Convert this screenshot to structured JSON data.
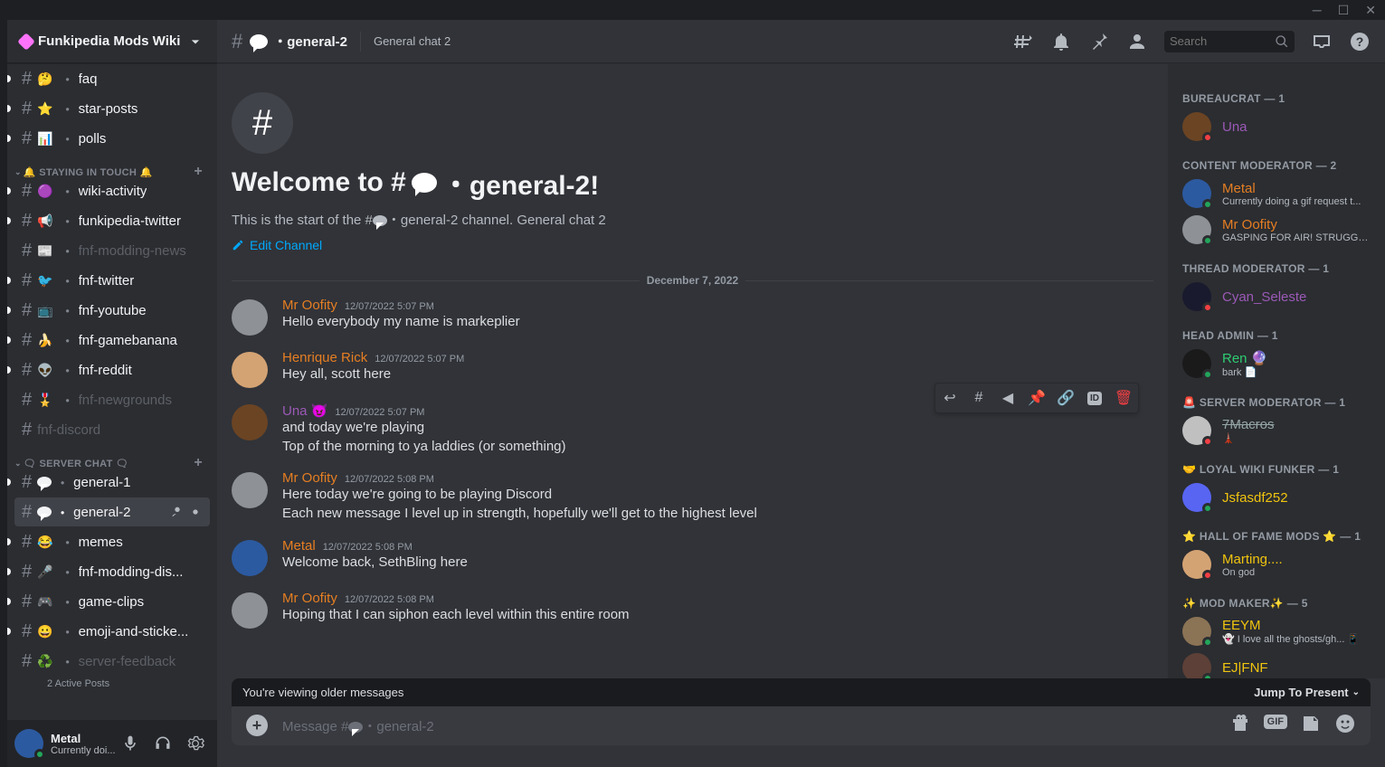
{
  "server": {
    "name": "Funkipedia Mods Wiki"
  },
  "categories": [
    {
      "name": "",
      "items": [
        {
          "emoji": "🤔",
          "label": "faq",
          "unread": true,
          "indicator": true
        },
        {
          "emoji": "⭐",
          "label": "star-posts",
          "unread": true,
          "indicator": true
        },
        {
          "emoji": "📊",
          "label": "polls",
          "unread": true,
          "indicator": true
        }
      ]
    },
    {
      "name": "🔔 STAYING IN TOUCH 🔔",
      "add": true,
      "items": [
        {
          "emoji": "🟣",
          "label": "wiki-activity",
          "unread": true,
          "indicator": true
        },
        {
          "emoji": "📢",
          "label": "funkipedia-twitter",
          "unread": true,
          "indicator": true
        },
        {
          "emoji": "📰",
          "label": "fnf-modding-news",
          "muted": true
        },
        {
          "emoji": "🐦",
          "label": "fnf-twitter",
          "unread": true,
          "indicator": true
        },
        {
          "emoji": "📺",
          "label": "fnf-youtube",
          "unread": true,
          "indicator": true
        },
        {
          "emoji": "🍌",
          "label": "fnf-gamebanana",
          "unread": true,
          "indicator": true
        },
        {
          "emoji": "👽",
          "label": "fnf-reddit",
          "unread": true,
          "indicator": true
        },
        {
          "emoji": "🎖️",
          "label": "fnf-newgrounds",
          "muted": true
        },
        {
          "emoji": "",
          "label": "fnf-discord",
          "muted": true
        }
      ]
    },
    {
      "name": "🗨 SERVER CHAT 🗨",
      "add": true,
      "items": [
        {
          "emoji": "💬",
          "label": "general-1",
          "unread": true,
          "indicator": true,
          "speech": true
        },
        {
          "emoji": "💬",
          "label": "general-2",
          "active": true,
          "speech": true,
          "hover": true
        },
        {
          "emoji": "😂",
          "label": "memes",
          "unread": true,
          "indicator": true
        },
        {
          "emoji": "🎤",
          "label": "fnf-modding-dis...",
          "unread": true,
          "indicator": true
        },
        {
          "emoji": "🎮",
          "label": "game-clips",
          "unread": true,
          "indicator": true
        },
        {
          "emoji": "😀",
          "label": "emoji-and-sticke...",
          "unread": true,
          "indicator": true
        },
        {
          "emoji": "♻️",
          "label": "server-feedback",
          "muted": true,
          "posts": "2 Active Posts"
        }
      ]
    }
  ],
  "userPanel": {
    "name": "Metal",
    "status": "Currently doi...",
    "statusDot": "online"
  },
  "header": {
    "channel": "・general-2",
    "topic": "General chat 2",
    "search": "Search"
  },
  "welcome": {
    "title_pre": "Welcome to #",
    "title_post": "・general-2!",
    "sub_pre": "This is the start of the #",
    "sub_post": "・general-2 channel. General chat 2",
    "edit": "Edit Channel"
  },
  "dateDivider": "December 7, 2022",
  "messages": [
    {
      "author": "Mr Oofity",
      "color": "#e67e22",
      "time": "12/07/2022 5:07 PM",
      "avatar": "#8e9297",
      "lines": [
        "Hello everybody my name is markeplier"
      ]
    },
    {
      "author": "Henrique Rick",
      "color": "#e67e22",
      "time": "12/07/2022 5:07 PM",
      "avatar": "#d4a373",
      "lines": [
        "Hey all, scott here"
      ]
    },
    {
      "author": "Una",
      "color": "#9b59b6",
      "time": "12/07/2022 5:07 PM",
      "avatar": "#6b4423",
      "badge": "😈",
      "hover": true,
      "lines": [
        "and today we're playing",
        "Top of the morning to ya laddies (or something)"
      ]
    },
    {
      "author": "Mr Oofity",
      "color": "#e67e22",
      "time": "12/07/2022 5:08 PM",
      "avatar": "#8e9297",
      "lines": [
        "Here today we're going to be playing Discord",
        "Each new message I level up in strength, hopefully we'll get to the highest level"
      ]
    },
    {
      "author": "Metal",
      "color": "#e67e22",
      "time": "12/07/2022 5:08 PM",
      "avatar": "#2c5aa0",
      "lines": [
        "Welcome back, SethBling here"
      ]
    },
    {
      "author": "Mr Oofity",
      "color": "#e67e22",
      "time": "12/07/2022 5:08 PM",
      "avatar": "#8e9297",
      "lines": [
        "Hoping that I can siphon each level within this entire room"
      ]
    }
  ],
  "oldBar": {
    "text": "You're viewing older messages",
    "jump": "Jump To Present"
  },
  "input": {
    "placeholder_pre": "Message #",
    "placeholder_post": "・general-2"
  },
  "roles": [
    {
      "name": "BUREAUCRAT — 1",
      "members": [
        {
          "name": "Una",
          "color": "#9b59b6",
          "status": "dnd",
          "avatar": "#6b4423"
        }
      ]
    },
    {
      "name": "CONTENT MODERATOR — 2",
      "members": [
        {
          "name": "Metal",
          "color": "#e67e22",
          "status": "online",
          "sub": "Currently doing a gif request t...",
          "avatar": "#2c5aa0"
        },
        {
          "name": "Mr Oofity",
          "color": "#e67e22",
          "status": "online",
          "sub": "GASPING FOR AIR! STRUGGL...",
          "avatar": "#8e9297"
        }
      ]
    },
    {
      "name": "THREAD MODERATOR — 1",
      "members": [
        {
          "name": "Cyan_Seleste",
          "color": "#9b59b6",
          "status": "dnd",
          "avatar": "#1a1a2e"
        }
      ]
    },
    {
      "name": "HEAD ADMIN — 1",
      "members": [
        {
          "name": "Ren 🔮",
          "color": "#2ecc71",
          "status": "online",
          "sub": "bark 📄",
          "avatar": "#1a1a1a"
        }
      ]
    },
    {
      "name": "🚨 SERVER MODERATOR — 1",
      "members": [
        {
          "name": "7Macros",
          "color": "#95a5a6",
          "status": "dnd",
          "sub": "🗼",
          "avatar": "#c0c0c0",
          "strike": true
        }
      ]
    },
    {
      "name": "🤝 LOYAL WIKI FUNKER — 1",
      "members": [
        {
          "name": "Jsfasdf252",
          "color": "#f1c40f",
          "status": "online",
          "avatar": "#5865f2"
        }
      ]
    },
    {
      "name": "⭐ HALL OF FAME MODS ⭐ — 1",
      "members": [
        {
          "name": "Marting....",
          "color": "#f1c40f",
          "status": "dnd",
          "sub": "On god",
          "avatar": "#d4a373"
        }
      ]
    },
    {
      "name": "✨ MOD MAKER✨ — 5",
      "members": [
        {
          "name": "EEYM",
          "color": "#f1c40f",
          "status": "online",
          "sub": "👻 I love all the ghosts/gh... 📱",
          "avatar": "#8b7355"
        },
        {
          "name": "EJ|FNF",
          "color": "#f1c40f",
          "status": "online",
          "avatar": "#5d4037"
        }
      ]
    }
  ]
}
